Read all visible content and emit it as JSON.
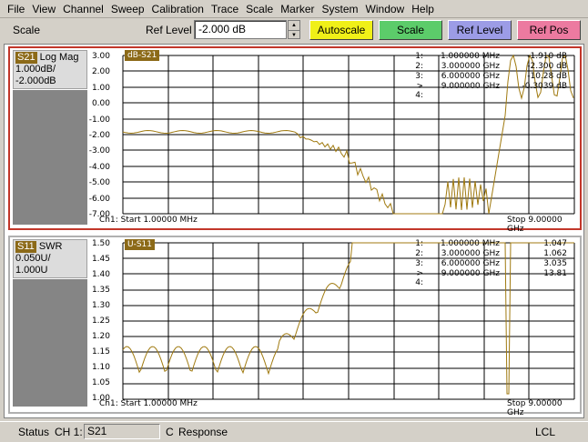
{
  "menubar": {
    "items": [
      "File",
      "View",
      "Channel",
      "Sweep",
      "Calibration",
      "Trace",
      "Scale",
      "Marker",
      "System",
      "Window",
      "Help"
    ]
  },
  "toolbar": {
    "title": "Scale",
    "ref_level_label": "Ref Level",
    "ref_level_value": "-2.000 dB",
    "buttons": {
      "autoscale": "Autoscale",
      "scale": "Scale",
      "ref_level": "Ref Level",
      "ref_pos": "Ref Pos"
    },
    "colors": {
      "autoscale": "#f0f018",
      "scale": "#5ccc6a",
      "ref_level": "#9c9ce6",
      "ref_pos": "#ec7aa0"
    }
  },
  "channels": [
    {
      "trace_tag": "S21",
      "trace_format": "Log Mag",
      "scale_line1": "1.000dB/",
      "scale_line2": "-2.000dB",
      "plot_tag": "dB-S21",
      "y_ticks": [
        "3.00",
        "2.00",
        "1.00",
        "0.00",
        "-1.00",
        "-2.00",
        "-3.00",
        "-4.00",
        "-5.00",
        "-6.00",
        "-7.00"
      ],
      "start_label": "Ch1: Start  1.00000 MHz",
      "stop_label": "Stop  9.00000 GHz",
      "markers": [
        {
          "idx": "1:",
          "freq": "1.000000 MHz",
          "val": "-1.910 dB"
        },
        {
          "idx": "2:",
          "freq": "3.000000 GHz",
          "val": "-2.300 dB"
        },
        {
          "idx": "3:",
          "freq": "6.000000 GHz",
          "val": "-10.28 dB"
        },
        {
          "idx": "> 4:",
          "freq": "9.000000 GHz",
          "val": "-0.3039 dB"
        }
      ],
      "border_color": "#c2372a"
    },
    {
      "trace_tag": "S11",
      "trace_format": "SWR",
      "scale_line1": "0.050U/",
      "scale_line2": "1.000U",
      "plot_tag": "U-S11",
      "y_ticks": [
        "1.50",
        "1.45",
        "1.40",
        "1.35",
        "1.30",
        "1.25",
        "1.20",
        "1.15",
        "1.10",
        "1.05",
        "1.00"
      ],
      "start_label": "Ch1: Start  1.00000 MHz",
      "stop_label": "Stop  9.00000 GHz",
      "markers": [
        {
          "idx": "1:",
          "freq": "1.000000 MHz",
          "val": "1.047"
        },
        {
          "idx": "2:",
          "freq": "3.000000 GHz",
          "val": "1.062"
        },
        {
          "idx": "3:",
          "freq": "6.000000 GHz",
          "val": "3.035"
        },
        {
          "idx": "> 4:",
          "freq": "9.000000 GHz",
          "val": "13.81"
        }
      ],
      "border_color": "#b0b0b0"
    }
  ],
  "statusbar": {
    "status_label": "Status",
    "channel_label": "CH 1:",
    "trace_field": "S21",
    "cal_label": "C",
    "response_label": "Response",
    "lcl_label": "LCL"
  },
  "trace_color": "#a07a10"
}
